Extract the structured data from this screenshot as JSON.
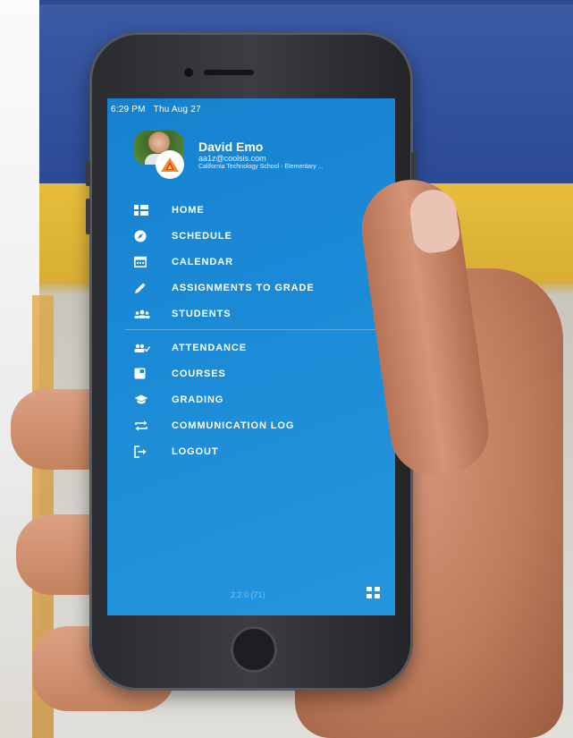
{
  "status_bar": {
    "time": "6:29 PM",
    "date": "Thu Aug 27"
  },
  "profile": {
    "name": "David Emo",
    "email": "aa1z@coolsis.com",
    "school": "California Technology School - Elementary ..."
  },
  "menu": {
    "group1": [
      {
        "label": "HOME",
        "icon": "home-list-icon"
      },
      {
        "label": "SCHEDULE",
        "icon": "compass-icon"
      },
      {
        "label": "CALENDAR",
        "icon": "calendar-icon"
      },
      {
        "label": "ASSIGNMENTS TO GRADE",
        "icon": "pencil-icon"
      },
      {
        "label": "STUDENTS",
        "icon": "group-icon"
      }
    ],
    "group2": [
      {
        "label": "ATTENDANCE",
        "icon": "attendance-icon"
      },
      {
        "label": "COURSES",
        "icon": "book-icon"
      },
      {
        "label": "GRADING",
        "icon": "graduation-cap-icon"
      },
      {
        "label": "COMMUNICATION LOG",
        "icon": "repeat-icon"
      },
      {
        "label": "LOGOUT",
        "icon": "logout-icon"
      }
    ]
  },
  "footer": {
    "version": "2.2.0 (71)",
    "apps_icon": "grid-icon"
  },
  "colors": {
    "screen_blue": "#1b8ad6",
    "text": "#ffffff",
    "version_text": "#7fc3ee"
  }
}
